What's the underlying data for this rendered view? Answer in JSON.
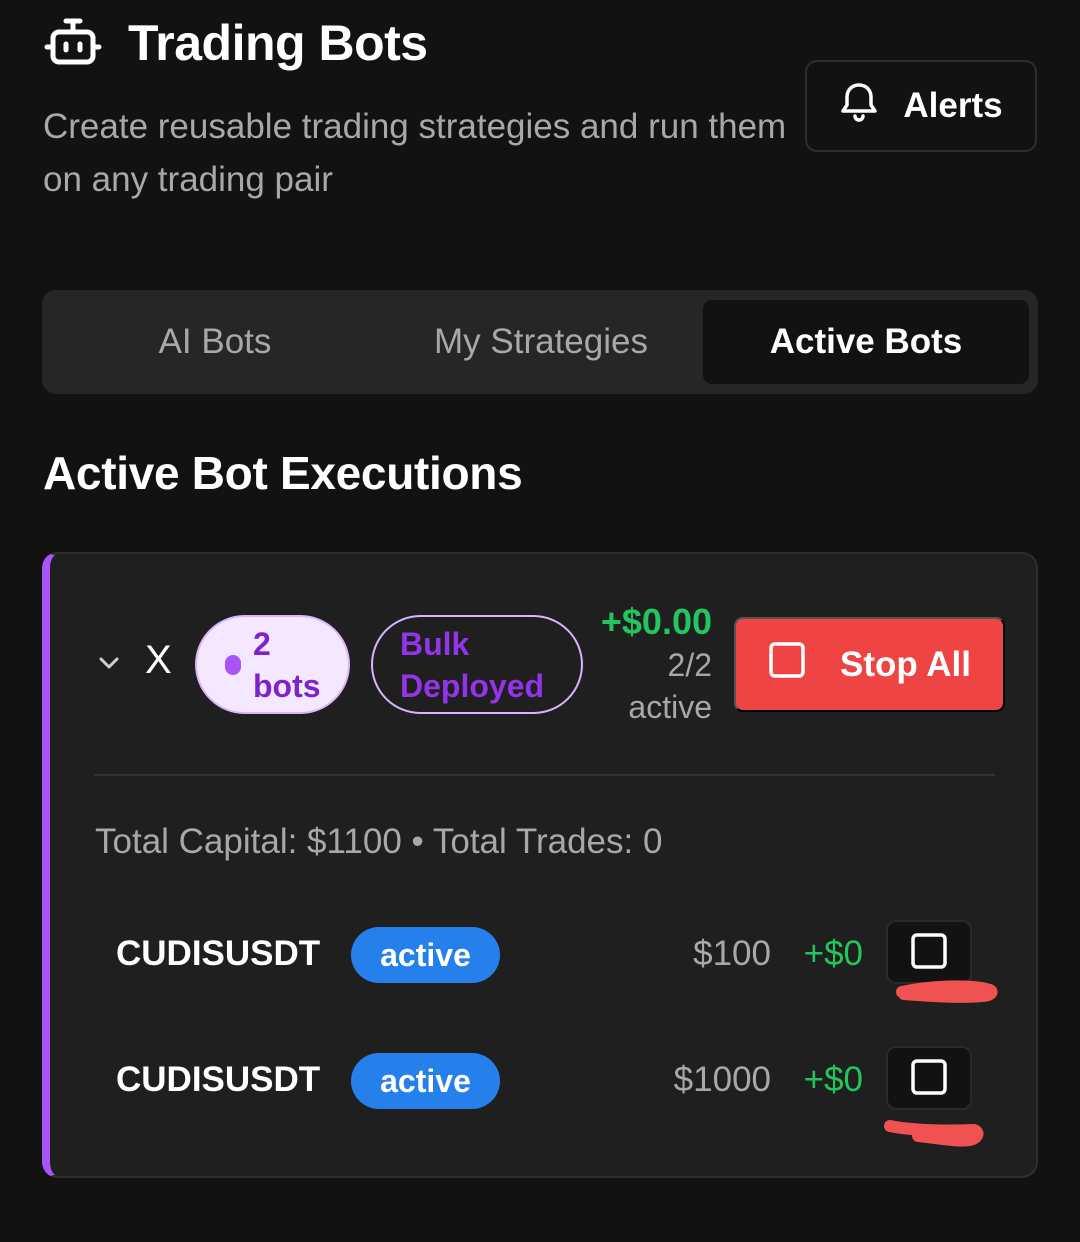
{
  "header": {
    "icon": "robot-icon",
    "title": "Trading Bots",
    "subtitle": "Create reusable trading strategies and run them on any trading pair",
    "alerts_label": "Alerts"
  },
  "tabs": [
    {
      "label": "AI Bots",
      "active": false
    },
    {
      "label": "My Strategies",
      "active": false
    },
    {
      "label": "Active Bots",
      "active": true
    }
  ],
  "section_title": "Active Bot Executions",
  "execution": {
    "name": "X",
    "bots_badge": "2 bots",
    "deploy_badge": "Bulk Deployed",
    "pnl": "+$0.00",
    "active_count": "2/2 active",
    "stop_all_label": "Stop All",
    "totals": "Total Capital: $1100 • Total Trades: 0",
    "bots": [
      {
        "symbol": "CUDISUSDT",
        "status": "active",
        "capital": "$100",
        "pnl": "+$0"
      },
      {
        "symbol": "CUDISUSDT",
        "status": "active",
        "capital": "$1000",
        "pnl": "+$0"
      }
    ]
  },
  "colors": {
    "background": "#121212",
    "card": "#1f1f1f",
    "accent_purple": "#a855f7",
    "profit_green": "#22c55e",
    "danger_red": "#ef4444",
    "status_blue": "#2680eb",
    "annotation_red": "#f05252"
  }
}
